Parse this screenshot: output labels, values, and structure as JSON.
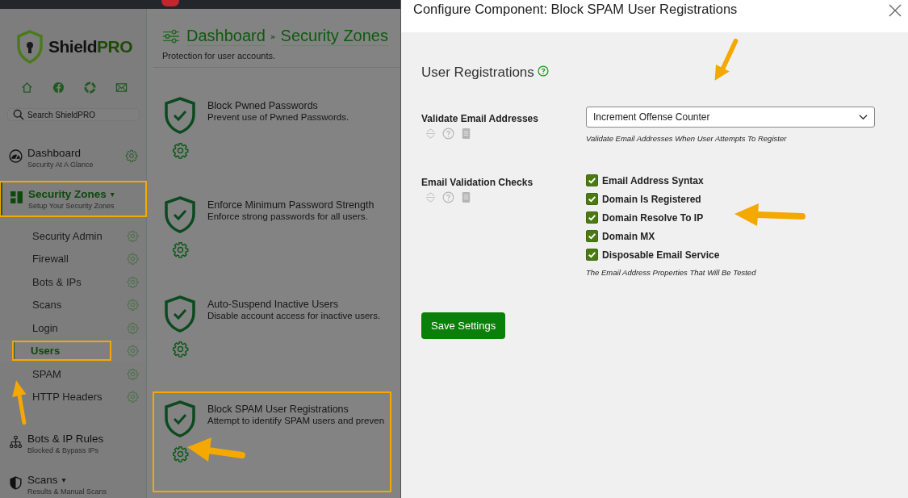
{
  "sidebar": {
    "brand": {
      "name": "Shield",
      "suffix": "PRO"
    },
    "search": {
      "placeholder": "Search ShieldPRO"
    },
    "nav": [
      {
        "title": "Dashboard",
        "subtitle": "Security At A Glance",
        "kind": "gauge",
        "selected": false,
        "highlighted": false,
        "settings": true
      },
      {
        "title": "Security Zones",
        "subtitle": "Setup Your Security Zones",
        "kind": "grid",
        "caret": "▾",
        "selected": true,
        "highlighted": true,
        "settings": false,
        "children": [
          {
            "title": "Security Admin",
            "selected": false,
            "highlighted": false
          },
          {
            "title": "Firewall",
            "selected": false,
            "highlighted": false
          },
          {
            "title": "Bots & IPs",
            "selected": false,
            "highlighted": false
          },
          {
            "title": "Scans",
            "selected": false,
            "highlighted": false
          },
          {
            "title": "Login",
            "selected": false,
            "highlighted": false
          },
          {
            "title": "Users",
            "selected": true,
            "highlighted": true
          },
          {
            "title": "SPAM",
            "selected": false,
            "highlighted": false
          },
          {
            "title": "HTTP Headers",
            "selected": false,
            "highlighted": false
          }
        ]
      },
      {
        "title": "Bots & IP Rules",
        "subtitle": "Blocked & Bypass IPs",
        "kind": "network",
        "selected": false,
        "highlighted": false,
        "settings": false
      },
      {
        "title": "Scans",
        "subtitle": "Results & Manual Scans",
        "kind": "shield",
        "caret": "▾",
        "selected": false,
        "highlighted": false,
        "settings": false
      }
    ]
  },
  "content": {
    "breadcrumb": [
      "Dashboard",
      "Security Zones"
    ],
    "separator": "»",
    "description": "Protection for user accounts.",
    "cards": [
      {
        "title": "Block Pwned Passwords",
        "description": "Prevent use of Pwned Passwords.",
        "highlighted": false
      },
      {
        "title": "Enforce Minimum Password Strength",
        "description": "Enforce strong passwords for all users.",
        "highlighted": false
      },
      {
        "title": "Auto-Suspend Inactive Users",
        "description": "Disable account access for inactive users.",
        "highlighted": false
      },
      {
        "title": "Block SPAM User Registrations",
        "description": "Attempt to identify SPAM users and preven",
        "highlighted": true
      }
    ]
  },
  "modal": {
    "title": "Configure Component: Block SPAM User Registrations",
    "section": "User Registrations",
    "fields": [
      {
        "kind": "select",
        "label": "Validate Email Addresses",
        "value": "Increment Offense Counter",
        "hint": "Validate Email Addresses When User Attempts To Register"
      },
      {
        "kind": "checklist",
        "label": "Email Validation Checks",
        "hint": "The Email Address Properties That Will Be Tested",
        "options": [
          {
            "label": "Email Address Syntax",
            "checked": true
          },
          {
            "label": "Domain Is Registered",
            "checked": true
          },
          {
            "label": "Domain Resolve To IP",
            "checked": true
          },
          {
            "label": "Domain MX",
            "checked": true
          },
          {
            "label": "Disposable Email Service",
            "checked": true
          }
        ]
      }
    ],
    "button": "Save Settings"
  }
}
